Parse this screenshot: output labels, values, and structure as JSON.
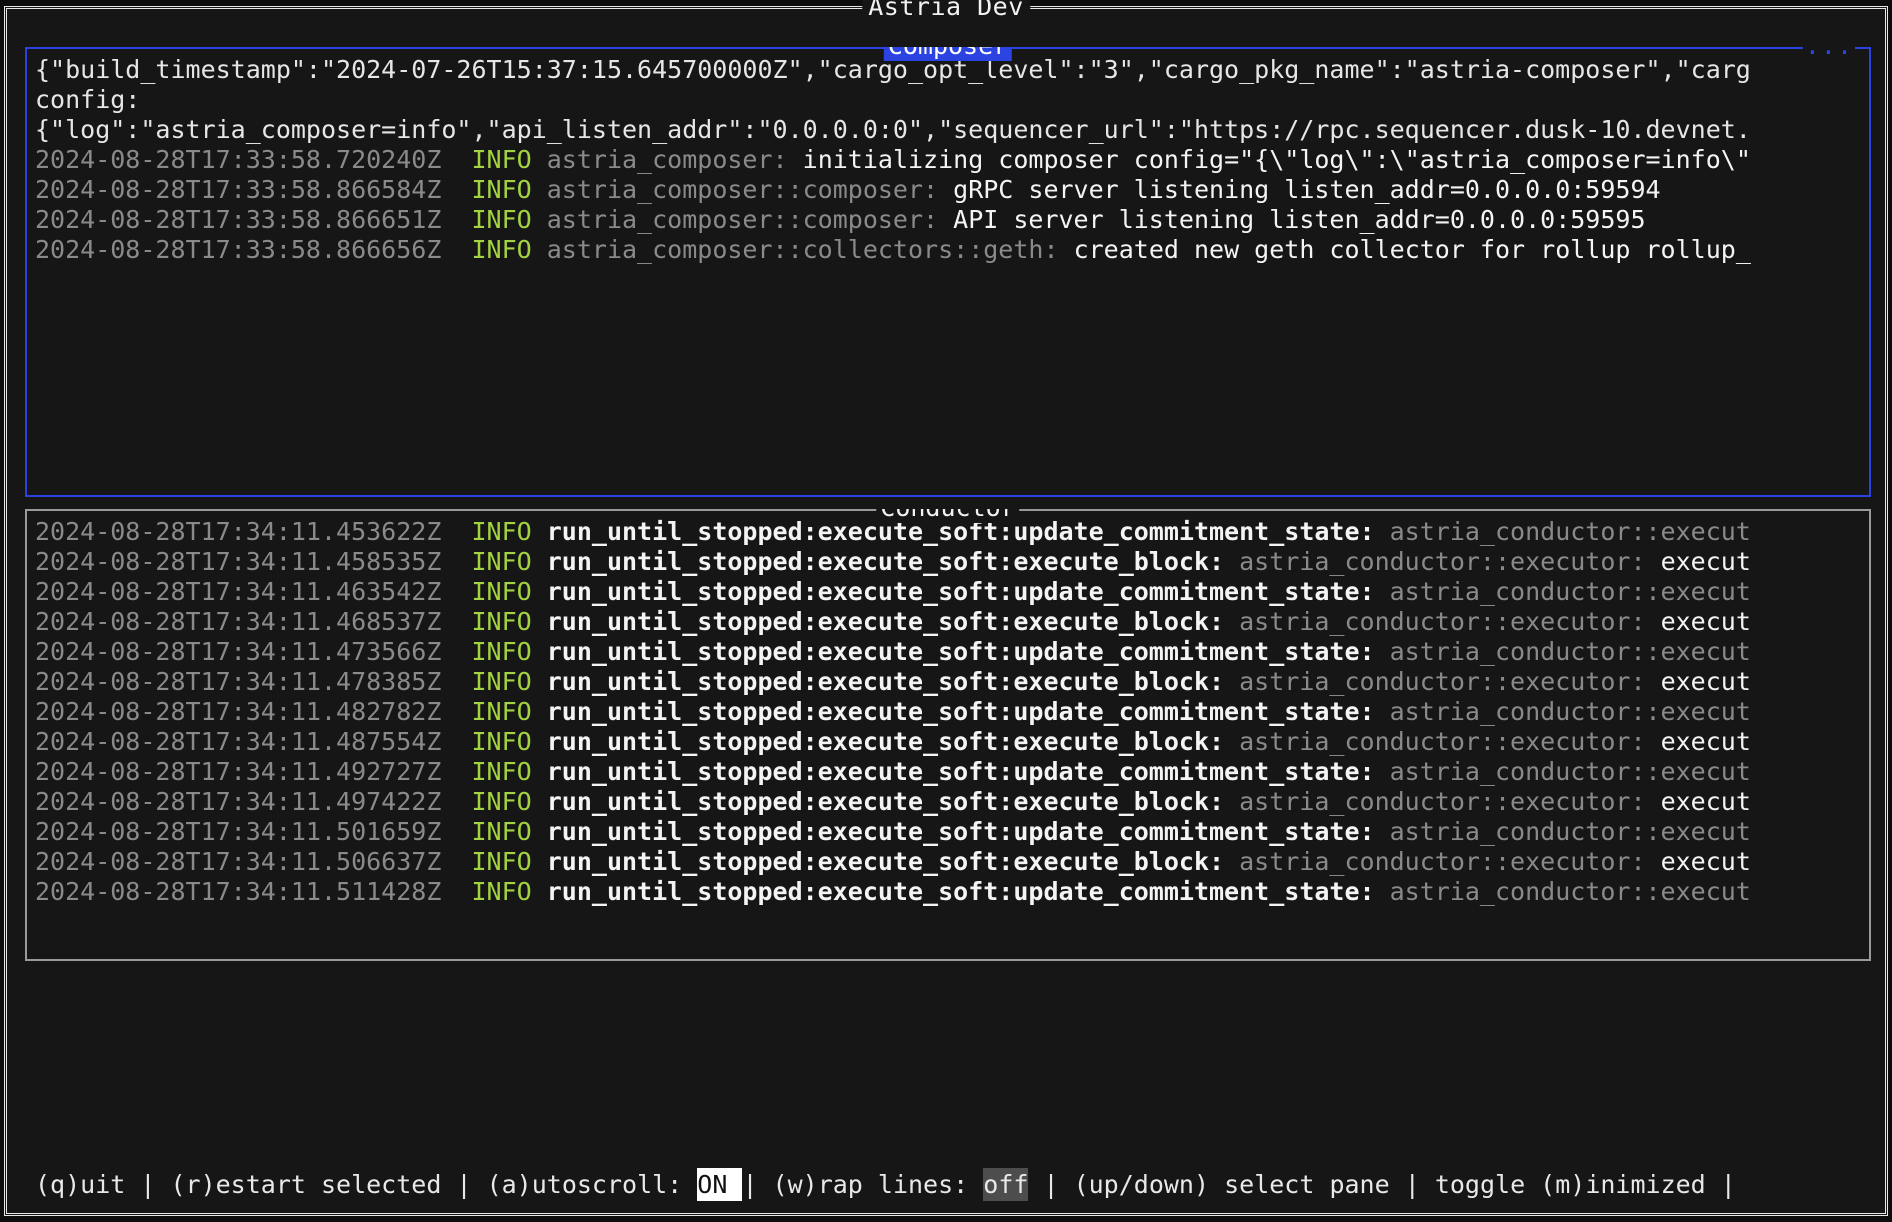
{
  "window": {
    "title": "Astria Dev"
  },
  "panes": [
    {
      "id": "composer",
      "title": "Composer",
      "focused": true,
      "overflow_indicator": "...",
      "lines": [
        {
          "segments": [
            {
              "style": "plain",
              "text": "{\"build_timestamp\":\"2024-07-26T15:37:15.645700000Z\",\"cargo_opt_level\":\"3\",\"cargo_pkg_name\":\"astria-composer\",\"carg"
            }
          ]
        },
        {
          "segments": [
            {
              "style": "plain",
              "text": "config:"
            }
          ]
        },
        {
          "segments": [
            {
              "style": "plain",
              "text": "{\"log\":\"astria_composer=info\",\"api_listen_addr\":\"0.0.0.0:0\",\"sequencer_url\":\"https://rpc.sequencer.dusk-10.devnet."
            }
          ]
        },
        {
          "segments": [
            {
              "style": "dim",
              "text": "2024-08-28T17:33:58.720240Z "
            },
            {
              "style": "info",
              "text": " INFO"
            },
            {
              "style": "target",
              "text": " astria_composer: "
            },
            {
              "style": "msg",
              "text": "initializing composer config=\"{\\\"log\\\":\\\"astria_composer=info\\\""
            }
          ]
        },
        {
          "segments": [
            {
              "style": "dim",
              "text": "2024-08-28T17:33:58.866584Z "
            },
            {
              "style": "info",
              "text": " INFO"
            },
            {
              "style": "target",
              "text": " astria_composer::composer: "
            },
            {
              "style": "msg",
              "text": "gRPC server listening listen_addr=0.0.0.0:59594"
            }
          ]
        },
        {
          "segments": [
            {
              "style": "dim",
              "text": "2024-08-28T17:33:58.866651Z "
            },
            {
              "style": "info",
              "text": " INFO"
            },
            {
              "style": "target",
              "text": " astria_composer::composer: "
            },
            {
              "style": "msg",
              "text": "API server listening listen_addr=0.0.0.0:59595"
            }
          ]
        },
        {
          "segments": [
            {
              "style": "dim",
              "text": "2024-08-28T17:33:58.866656Z "
            },
            {
              "style": "info",
              "text": " INFO"
            },
            {
              "style": "target",
              "text": " astria_composer::collectors::geth: "
            },
            {
              "style": "msg",
              "text": "created new geth collector for rollup rollup_"
            }
          ]
        }
      ]
    },
    {
      "id": "conductor",
      "title": "Conductor",
      "focused": false,
      "overflow_indicator": "",
      "lines": [
        {
          "segments": [
            {
              "style": "dim",
              "text": "2024-08-28T17:34:11.453622Z "
            },
            {
              "style": "info",
              "text": " INFO"
            },
            {
              "style": "span",
              "text": " run_until_stopped:execute_soft:update_commitment_state:"
            },
            {
              "style": "target",
              "text": " astria_conductor::execut"
            }
          ]
        },
        {
          "segments": [
            {
              "style": "dim",
              "text": "2024-08-28T17:34:11.458535Z "
            },
            {
              "style": "info",
              "text": " INFO"
            },
            {
              "style": "span",
              "text": " run_until_stopped:execute_soft:execute_block:"
            },
            {
              "style": "target",
              "text": " astria_conductor::executor: "
            },
            {
              "style": "msg",
              "text": "execut"
            }
          ]
        },
        {
          "segments": [
            {
              "style": "dim",
              "text": "2024-08-28T17:34:11.463542Z "
            },
            {
              "style": "info",
              "text": " INFO"
            },
            {
              "style": "span",
              "text": " run_until_stopped:execute_soft:update_commitment_state:"
            },
            {
              "style": "target",
              "text": " astria_conductor::execut"
            }
          ]
        },
        {
          "segments": [
            {
              "style": "dim",
              "text": "2024-08-28T17:34:11.468537Z "
            },
            {
              "style": "info",
              "text": " INFO"
            },
            {
              "style": "span",
              "text": " run_until_stopped:execute_soft:execute_block:"
            },
            {
              "style": "target",
              "text": " astria_conductor::executor: "
            },
            {
              "style": "msg",
              "text": "execut"
            }
          ]
        },
        {
          "segments": [
            {
              "style": "dim",
              "text": "2024-08-28T17:34:11.473566Z "
            },
            {
              "style": "info",
              "text": " INFO"
            },
            {
              "style": "span",
              "text": " run_until_stopped:execute_soft:update_commitment_state:"
            },
            {
              "style": "target",
              "text": " astria_conductor::execut"
            }
          ]
        },
        {
          "segments": [
            {
              "style": "dim",
              "text": "2024-08-28T17:34:11.478385Z "
            },
            {
              "style": "info",
              "text": " INFO"
            },
            {
              "style": "span",
              "text": " run_until_stopped:execute_soft:execute_block:"
            },
            {
              "style": "target",
              "text": " astria_conductor::executor: "
            },
            {
              "style": "msg",
              "text": "execut"
            }
          ]
        },
        {
          "segments": [
            {
              "style": "dim",
              "text": "2024-08-28T17:34:11.482782Z "
            },
            {
              "style": "info",
              "text": " INFO"
            },
            {
              "style": "span",
              "text": " run_until_stopped:execute_soft:update_commitment_state:"
            },
            {
              "style": "target",
              "text": " astria_conductor::execut"
            }
          ]
        },
        {
          "segments": [
            {
              "style": "dim",
              "text": "2024-08-28T17:34:11.487554Z "
            },
            {
              "style": "info",
              "text": " INFO"
            },
            {
              "style": "span",
              "text": " run_until_stopped:execute_soft:execute_block:"
            },
            {
              "style": "target",
              "text": " astria_conductor::executor: "
            },
            {
              "style": "msg",
              "text": "execut"
            }
          ]
        },
        {
          "segments": [
            {
              "style": "dim",
              "text": "2024-08-28T17:34:11.492727Z "
            },
            {
              "style": "info",
              "text": " INFO"
            },
            {
              "style": "span",
              "text": " run_until_stopped:execute_soft:update_commitment_state:"
            },
            {
              "style": "target",
              "text": " astria_conductor::execut"
            }
          ]
        },
        {
          "segments": [
            {
              "style": "dim",
              "text": "2024-08-28T17:34:11.497422Z "
            },
            {
              "style": "info",
              "text": " INFO"
            },
            {
              "style": "span",
              "text": " run_until_stopped:execute_soft:execute_block:"
            },
            {
              "style": "target",
              "text": " astria_conductor::executor: "
            },
            {
              "style": "msg",
              "text": "execut"
            }
          ]
        },
        {
          "segments": [
            {
              "style": "dim",
              "text": "2024-08-28T17:34:11.501659Z "
            },
            {
              "style": "info",
              "text": " INFO"
            },
            {
              "style": "span",
              "text": " run_until_stopped:execute_soft:update_commitment_state:"
            },
            {
              "style": "target",
              "text": " astria_conductor::execut"
            }
          ]
        },
        {
          "segments": [
            {
              "style": "dim",
              "text": "2024-08-28T17:34:11.506637Z "
            },
            {
              "style": "info",
              "text": " INFO"
            },
            {
              "style": "span",
              "text": " run_until_stopped:execute_soft:execute_block:"
            },
            {
              "style": "target",
              "text": " astria_conductor::executor: "
            },
            {
              "style": "msg",
              "text": "execut"
            }
          ]
        },
        {
          "segments": [
            {
              "style": "dim",
              "text": "2024-08-28T17:34:11.511428Z "
            },
            {
              "style": "info",
              "text": " INFO"
            },
            {
              "style": "span",
              "text": " run_until_stopped:execute_soft:update_commitment_state:"
            },
            {
              "style": "target",
              "text": " astria_conductor::execut"
            }
          ]
        }
      ]
    }
  ],
  "status_bar": {
    "items": [
      {
        "kind": "text",
        "text": "(q)uit"
      },
      {
        "kind": "sep",
        "text": " | "
      },
      {
        "kind": "text",
        "text": "(r)estart selected"
      },
      {
        "kind": "sep",
        "text": " | "
      },
      {
        "kind": "text",
        "text": "(a)utoscroll: "
      },
      {
        "kind": "badge-on",
        "text": "ON "
      },
      {
        "kind": "sep",
        "text": " | "
      },
      {
        "kind": "text",
        "text": "(w)rap lines: "
      },
      {
        "kind": "badge-off",
        "text": "off"
      },
      {
        "kind": "sep",
        "text": " | "
      },
      {
        "kind": "text",
        "text": "(up/down) select pane"
      },
      {
        "kind": "sep",
        "text": " | "
      },
      {
        "kind": "text",
        "text": "toggle (m)inimized"
      },
      {
        "kind": "sep",
        "text": " | "
      }
    ]
  },
  "colors": {
    "background": "#161616",
    "focus_border": "#2b43e0",
    "idle_border": "#9a9a9a",
    "info_level": "#a3d340",
    "dim_text": "#8a8a8a",
    "bright_text": "#f4f4f4",
    "badge_on_bg": "#ffffff",
    "badge_off_bg": "#4d4d4d"
  }
}
